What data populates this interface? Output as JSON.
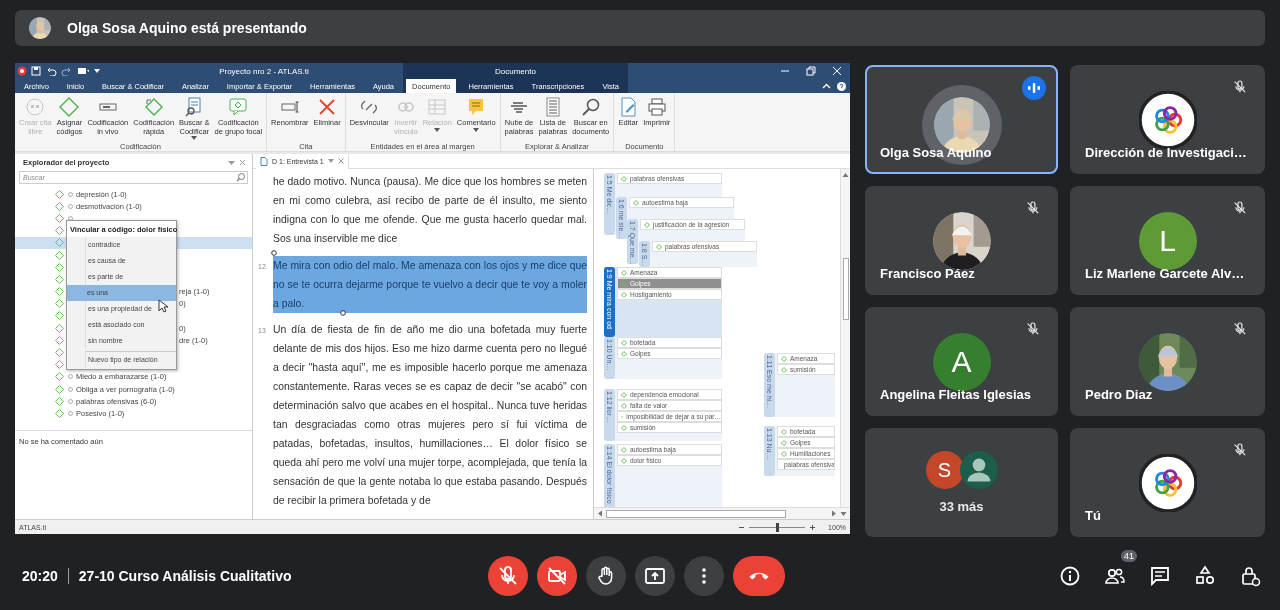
{
  "presenter_banner": {
    "text": "Olga Sosa Aquino está presentando"
  },
  "shared_window": {
    "title": "Proyecto nro 2 - ATLAS.ti",
    "context_group": "Documento",
    "menu_tabs": [
      {
        "label": "Archivo",
        "selected": false,
        "context": false
      },
      {
        "label": "Inicio",
        "selected": false,
        "context": false
      },
      {
        "label": "Buscar & Codificar",
        "selected": false,
        "context": false
      },
      {
        "label": "Analizar",
        "selected": false,
        "context": false
      },
      {
        "label": "Importar & Exportar",
        "selected": false,
        "context": false
      },
      {
        "label": "Herramientas",
        "selected": false,
        "context": false
      },
      {
        "label": "Ayuda",
        "selected": false,
        "context": false
      },
      {
        "label": "Documento",
        "selected": true,
        "context": true
      },
      {
        "label": "Herramientas",
        "selected": false,
        "context": true
      },
      {
        "label": "Transcripciones",
        "selected": false,
        "context": true
      },
      {
        "label": "Vista",
        "selected": false,
        "context": true
      }
    ],
    "ribbon_groups": [
      {
        "label": "Codificación",
        "buttons": [
          {
            "label": "Crear cita\nlibre",
            "kind": "quote-free",
            "disabled": true,
            "dropdown": false
          },
          {
            "label": "Asignar\ncódigos",
            "kind": "code-assign",
            "disabled": false,
            "dropdown": false
          },
          {
            "label": "Codificación\nin vivo",
            "kind": "code-invivo",
            "disabled": false,
            "dropdown": false
          },
          {
            "label": "Codificación\nrápida",
            "kind": "code-quick",
            "disabled": false,
            "dropdown": false
          },
          {
            "label": "Buscar &\nCodificar",
            "kind": "search-code",
            "disabled": false,
            "dropdown": true
          },
          {
            "label": "Codificación\nde grupo focal",
            "kind": "focus-group",
            "disabled": false,
            "dropdown": false
          }
        ]
      },
      {
        "label": "Cita",
        "buttons": [
          {
            "label": "Renombrar",
            "kind": "rename",
            "disabled": false,
            "dropdown": false
          },
          {
            "label": "Eliminar",
            "kind": "delete",
            "disabled": false,
            "dropdown": false
          }
        ]
      },
      {
        "label": "Entidades en el área al margen",
        "buttons": [
          {
            "label": "Desvincular",
            "kind": "unlink",
            "disabled": false,
            "dropdown": false
          },
          {
            "label": "Invertir\nvínculo",
            "kind": "invert-link",
            "disabled": true,
            "dropdown": false
          },
          {
            "label": "Relación",
            "kind": "relation",
            "disabled": true,
            "dropdown": true
          },
          {
            "label": "Comentario",
            "kind": "comment",
            "disabled": false,
            "dropdown": true
          }
        ]
      },
      {
        "label": "Explorar & Analizar",
        "buttons": [
          {
            "label": "Nube de\npalabras",
            "kind": "word-cloud",
            "disabled": false,
            "dropdown": false
          },
          {
            "label": "Lista de\npalabras",
            "kind": "word-list",
            "disabled": false,
            "dropdown": false
          },
          {
            "label": "Buscar en\ndocumento",
            "kind": "search",
            "disabled": false,
            "dropdown": false
          }
        ]
      },
      {
        "label": "Documento",
        "buttons": [
          {
            "label": "Editar",
            "kind": "edit",
            "disabled": false,
            "dropdown": false
          },
          {
            "label": "Imprimir",
            "kind": "print",
            "disabled": false,
            "dropdown": false
          }
        ]
      }
    ],
    "explorer": {
      "title": "Explorador del proyecto",
      "search": {
        "placeholder": "Buscar"
      },
      "rows": [
        {
          "label": "depresión (1-0)",
          "selected": false
        },
        {
          "label": "desmotivación (1-0)",
          "selected": false
        },
        {
          "selected": false
        },
        {
          "selected": false
        },
        {
          "selected": true
        },
        {
          "selected": false
        },
        {
          "selected": false
        },
        {
          "selected": false
        },
        {
          "visible_tail": "reja (1-0)",
          "selected": false
        },
        {
          "visible_tail": "0)",
          "selected": false
        },
        {
          "selected": false
        },
        {
          "visible_tail": "0)",
          "selected": false
        },
        {
          "visible_tail": "dre (1-0)",
          "selected": false
        },
        {
          "selected": false
        },
        {
          "selected": false
        },
        {
          "label": "Miedo a embarazarse (1-0)",
          "selected": false
        },
        {
          "label": "Obliga a ver pornografía (1-0)",
          "selected": false
        },
        {
          "label": "palabras ofensivas (6-0)",
          "selected": false
        },
        {
          "label": "Posesivo (1-0)",
          "selected": false
        }
      ],
      "comment": "No se ha comentado aún",
      "context_menu": {
        "title": "Vincular a código: dolor físico",
        "items": [
          {
            "label": "contradice",
            "kind": "relation",
            "selected": false
          },
          {
            "label": "es causa de",
            "kind": "relation",
            "selected": false
          },
          {
            "label": "es parte de",
            "kind": "relation",
            "selected": false
          },
          {
            "label": "es una",
            "kind": "relation",
            "selected": true
          },
          {
            "label": "es una propiedad de",
            "kind": "relation",
            "selected": false
          },
          {
            "label": "está asociado con",
            "kind": "relation",
            "selected": false
          },
          {
            "label": "sin nombre",
            "kind": "relation",
            "selected": false
          },
          {
            "label": "Nuevo tipo de relación",
            "kind": "action",
            "selected": false
          }
        ]
      }
    },
    "document": {
      "tab": "D 1: Entrevista 1",
      "paragraphs": [
        {
          "text": "he dado motivo. Nunca (pausa). Me dice que los hombres se meten en mi como culebra, así recibo de parte de él insulto, me siento indigna con lo que me ofende. Que me gusta hacerlo quedar mal. Sos una inservible me dice",
          "selected": false
        },
        {
          "number": "12",
          "text": "Me mira con odio del malo. Me amenaza con los ojos y  me dice que no se te ocurra dejarme porque te vuelvo a decir que te voy a moler a palo.",
          "selected": true
        },
        {
          "number": "13",
          "text": "Un día de fiesta de fin de año me dio una bofetada muy fuerte delante de mis dos hijos. Eso me hizo darme cuenta pero no llegué a decir \"hasta aquí\", me es imposible hacerlo porque me amenaza constantemente. Raras veces se es capaz de decir \"se acabó\" con determinación salvo que acabes en el hospital.. Nunca tuve heridas tan desgraciadas como otras mujeres pero sí fui víctima de patadas, bofetadas, insultos, humillaciones… El dolor físico se queda ahí pero me volví una mujer torpe, acomplejada, que tenía la sensación de que la gente notaba lo que estaba pasando. Después de recibir la primera bofetada y de",
          "selected": false
        }
      ],
      "quotations": [
        {
          "label": "1:5 Me dic…",
          "selected": false,
          "codes": [
            {
              "label": "palabras ofensivas",
              "selected": false
            }
          ]
        },
        {
          "label": "1:6 me sie…",
          "selected": false,
          "codes": [
            {
              "label": "autoestima baja",
              "selected": false
            }
          ]
        },
        {
          "label": "1:7 Que me…",
          "selected": false,
          "codes": [
            {
              "label": "justificación de la agresión",
              "selected": false
            }
          ]
        },
        {
          "label": "1:8 S…",
          "selected": false,
          "codes": [
            {
              "label": "palabras ofensivas",
              "selected": false
            }
          ]
        },
        {
          "label": "1:9 Me mira con od",
          "selected": true,
          "codes": [
            {
              "label": "Amenaza",
              "selected": false
            },
            {
              "label": "Golpes",
              "selected": true
            },
            {
              "label": "Hostigamiento",
              "selected": false
            }
          ]
        },
        {
          "label": "1:10 Un…",
          "selected": false,
          "codes": [
            {
              "label": "bofetada",
              "selected": false
            },
            {
              "label": "Golpes",
              "selected": false
            }
          ]
        },
        {
          "label": "1:11 Eso me hi…",
          "selected": false,
          "codes": [
            {
              "label": "Amenaza",
              "selected": false
            },
            {
              "label": "sumisión",
              "selected": false
            }
          ]
        },
        {
          "label": "1:12 llor…",
          "selected": false,
          "codes": [
            {
              "label": "dependencia emocional",
              "selected": false
            },
            {
              "label": "falta de valor",
              "selected": false
            },
            {
              "label": "imposibilidad de dejar a su par…",
              "selected": false
            },
            {
              "label": "sumisión",
              "selected": false
            }
          ]
        },
        {
          "label": "1:13 Nu…",
          "selected": false,
          "codes": [
            {
              "label": "bofetada",
              "selected": false
            },
            {
              "label": "Golpes",
              "selected": false
            },
            {
              "label": "Humillaciones",
              "selected": false
            },
            {
              "label": "palabras ofensiva",
              "selected": false
            }
          ]
        },
        {
          "label": "1:14 El dolor físico",
          "selected": false,
          "codes": [
            {
              "label": "autoestima baja",
              "selected": false
            },
            {
              "label": "dolor físico",
              "selected": false
            }
          ]
        }
      ]
    },
    "status_bar": {
      "text": "ATLAS.ti",
      "zoom": {
        "level": 0.5,
        "reading": "100%"
      }
    }
  },
  "participants": [
    {
      "kind": "participant",
      "name": "Olga Sosa Aquino",
      "muted": false,
      "speaking": true
    },
    {
      "kind": "participant",
      "name": "Dirección de Investigaci…",
      "avatar": {
        "kind": "logo"
      },
      "muted": true,
      "speaking": false
    },
    {
      "kind": "participant",
      "name": "Francisco Páez",
      "muted": true,
      "speaking": false
    },
    {
      "kind": "participant",
      "name": "Liz Marlene Garcete Alv…",
      "avatar": {
        "kind": "letter",
        "initial": "L",
        "color": "#5e9b36"
      },
      "muted": true,
      "speaking": false
    },
    {
      "kind": "participant",
      "name": "Angelina Fleitas Iglesias",
      "avatar": {
        "kind": "letter",
        "initial": "A",
        "color": "#357f2e"
      },
      "muted": true,
      "speaking": false
    },
    {
      "kind": "participant",
      "name": "Pedro Diaz",
      "muted": true,
      "speaking": false
    },
    {
      "kind": "overflow",
      "label": "33 más",
      "avatars": [
        {
          "kind": "letter",
          "initial": "S",
          "color": "#c4472a"
        },
        {
          "kind": "silhouette",
          "color": "#1d5d4b"
        }
      ]
    },
    {
      "kind": "participant",
      "name": "Tú",
      "avatar": {
        "kind": "logo"
      },
      "muted": true,
      "speaking": false
    }
  ],
  "meeting": {
    "time": "20:20",
    "title": "27-10 Curso Análisis Cualitativo"
  },
  "controls": [
    {
      "kind": "mic",
      "on": false
    },
    {
      "kind": "camera",
      "on": false
    },
    {
      "kind": "raise-hand"
    },
    {
      "kind": "present"
    },
    {
      "kind": "more"
    },
    {
      "kind": "leave"
    }
  ],
  "side_buttons": [
    {
      "kind": "info"
    },
    {
      "kind": "people",
      "badge": "41"
    },
    {
      "kind": "chat"
    },
    {
      "kind": "activities"
    },
    {
      "kind": "host-controls"
    }
  ]
}
